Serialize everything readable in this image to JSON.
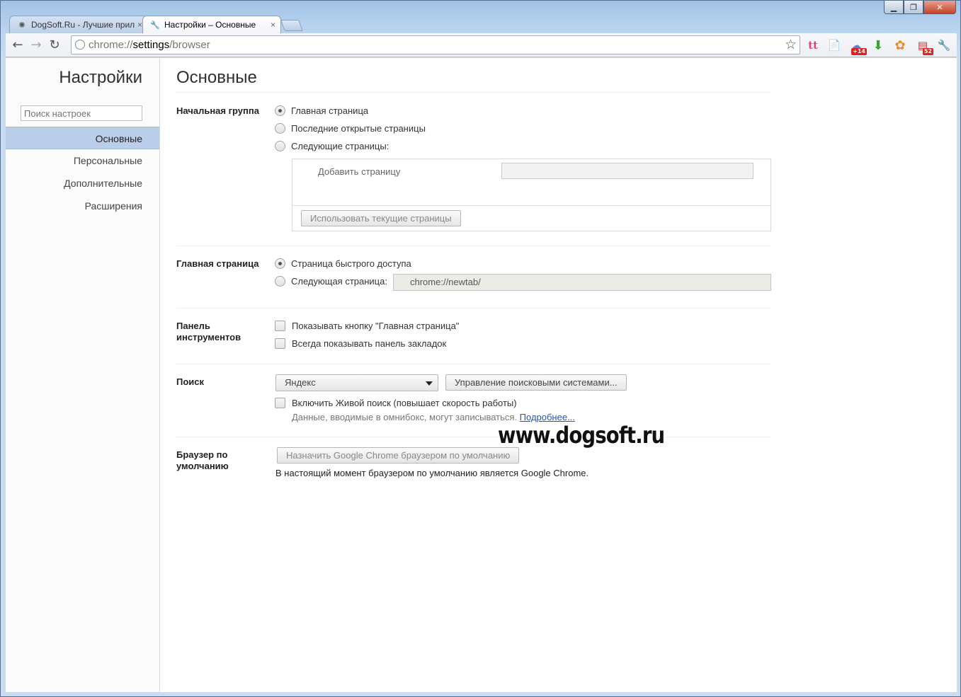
{
  "window": {
    "caption_min": "▁",
    "caption_max": "❐",
    "caption_close": "✕"
  },
  "tabs": [
    {
      "label": "DogSoft.Ru - Лучшие прил",
      "close": "×"
    },
    {
      "label": "Настройки – Основные",
      "close": "×"
    }
  ],
  "toolbar": {
    "back": "←",
    "forward": "→",
    "reload": "↻",
    "url_scheme": "chrome://",
    "url_host": "settings",
    "url_path": "/browser",
    "star": "☆",
    "extensions": [
      {
        "icon": "tt-icon",
        "glyph": "tt",
        "badge": ""
      },
      {
        "icon": "page-icon",
        "glyph": "📄",
        "badge": ""
      },
      {
        "icon": "weather-icon",
        "glyph": "☁",
        "badge": "+14"
      },
      {
        "icon": "download-icon",
        "glyph": "⬇",
        "badge": ""
      },
      {
        "icon": "paw-icon",
        "glyph": "✿",
        "badge": ""
      },
      {
        "icon": "mail-icon",
        "glyph": "▤",
        "badge": "52"
      },
      {
        "icon": "wrench-icon",
        "glyph": "🔧",
        "badge": ""
      }
    ]
  },
  "sidebar": {
    "title": "Настройки",
    "search_placeholder": "Поиск настроек",
    "items": [
      {
        "label": "Основные"
      },
      {
        "label": "Персональные"
      },
      {
        "label": "Дополнительные"
      },
      {
        "label": "Расширения"
      }
    ]
  },
  "main": {
    "title": "Основные",
    "startup": {
      "title": "Начальная группа",
      "options": [
        "Главная страница",
        "Последние открытые страницы",
        "Следующие страницы:"
      ],
      "selected": 0,
      "add_page": "Добавить страницу",
      "use_current": "Использовать текущие страницы"
    },
    "homepage": {
      "title": "Главная страница",
      "options": [
        "Страница быстрого доступа",
        "Следующая страница:"
      ],
      "selected": 0,
      "url": "chrome://newtab/"
    },
    "toolbar_section": {
      "title": "Панель инструментов",
      "checkboxes": [
        "Показывать кнопку \"Главная страница\"",
        "Всегда показывать панель закладок"
      ]
    },
    "search": {
      "title": "Поиск",
      "engine": "Яндекс",
      "manage": "Управление поисковыми системами...",
      "instant": "Включить Живой поиск (повышает скорость работы)",
      "note": "Данные, вводимые в омнибокс, могут записываться.",
      "more_link": "Подробнее..."
    },
    "default_browser": {
      "title": "Браузер по умолчанию",
      "button": "Назначить Google Chrome браузером по умолчанию",
      "status": "В настоящий момент браузером по умолчанию является Google Chrome."
    },
    "watermark": "www.dogsoft.ru"
  }
}
